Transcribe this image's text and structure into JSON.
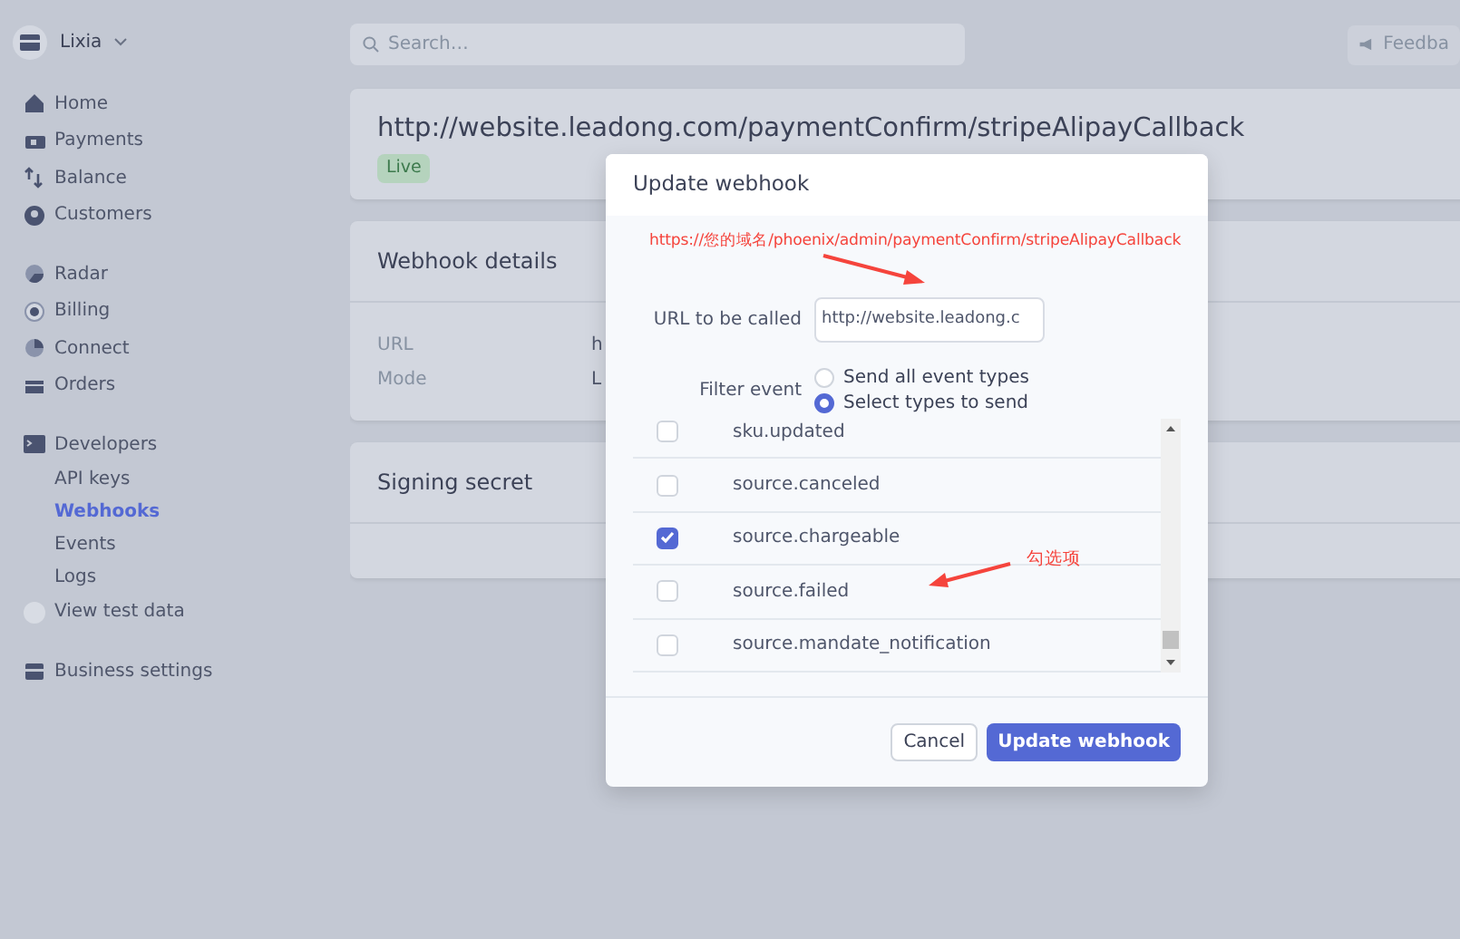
{
  "account": {
    "name": "Lixia"
  },
  "sidebar": {
    "groups": [
      {
        "items": [
          {
            "label": "Home",
            "kind": "main",
            "selected": false
          },
          {
            "label": "Payments",
            "kind": "main",
            "selected": false
          },
          {
            "label": "Balance",
            "kind": "main",
            "selected": false
          },
          {
            "label": "Customers",
            "kind": "main",
            "selected": false
          }
        ]
      },
      {
        "items": [
          {
            "label": "Radar",
            "kind": "main",
            "selected": false
          },
          {
            "label": "Billing",
            "kind": "main",
            "selected": false
          },
          {
            "label": "Connect",
            "kind": "main",
            "selected": false
          },
          {
            "label": "Orders",
            "kind": "main",
            "selected": false
          }
        ]
      },
      {
        "items": [
          {
            "label": "Developers",
            "kind": "main",
            "selected": false
          },
          {
            "label": "API keys",
            "kind": "sub",
            "selected": false
          },
          {
            "label": "Webhooks",
            "kind": "sub",
            "selected": true
          },
          {
            "label": "Events",
            "kind": "sub",
            "selected": false
          },
          {
            "label": "Logs",
            "kind": "sub",
            "selected": false
          },
          {
            "label": "View test data",
            "kind": "toggle",
            "on": false,
            "selected": false
          }
        ]
      },
      {
        "items": [
          {
            "label": "Business settings",
            "kind": "main",
            "selected": false
          }
        ]
      }
    ]
  },
  "search": {
    "placeholder": "Search…"
  },
  "feedback": "Feedba",
  "endpoint": {
    "url": "http://website.leadong.com/paymentConfirm/stripeAlipayCallback",
    "mode_badge": "Live"
  },
  "details": {
    "title": "Webhook details",
    "rows": [
      {
        "label": "URL",
        "value": "h"
      },
      {
        "label": "Mode",
        "value": "L"
      }
    ]
  },
  "signing": {
    "title": "Signing secret"
  },
  "modal": {
    "title": "Update webhook",
    "url_label": "URL to be called",
    "url_value": "http://website.leadong.c",
    "filter_label": "Filter event",
    "filter_options": [
      {
        "label": "Send all event types",
        "selected": false
      },
      {
        "label": "Select types to send",
        "selected": true
      }
    ],
    "events": [
      {
        "name": "sku.updated",
        "checked": false
      },
      {
        "name": "source.canceled",
        "checked": false
      },
      {
        "name": "source.chargeable",
        "checked": true
      },
      {
        "name": "source.failed",
        "checked": false
      },
      {
        "name": "source.mandate_notification",
        "checked": false
      }
    ],
    "buttons": [
      {
        "label": "Cancel",
        "kind": "secondary"
      },
      {
        "label": "Update webhook",
        "kind": "primary"
      }
    ]
  },
  "annotations": {
    "url_hint": "https://您的域名/phoenix/admin/paymentConfirm/stripeAlipayCallback",
    "check_hint": "勾选项"
  }
}
